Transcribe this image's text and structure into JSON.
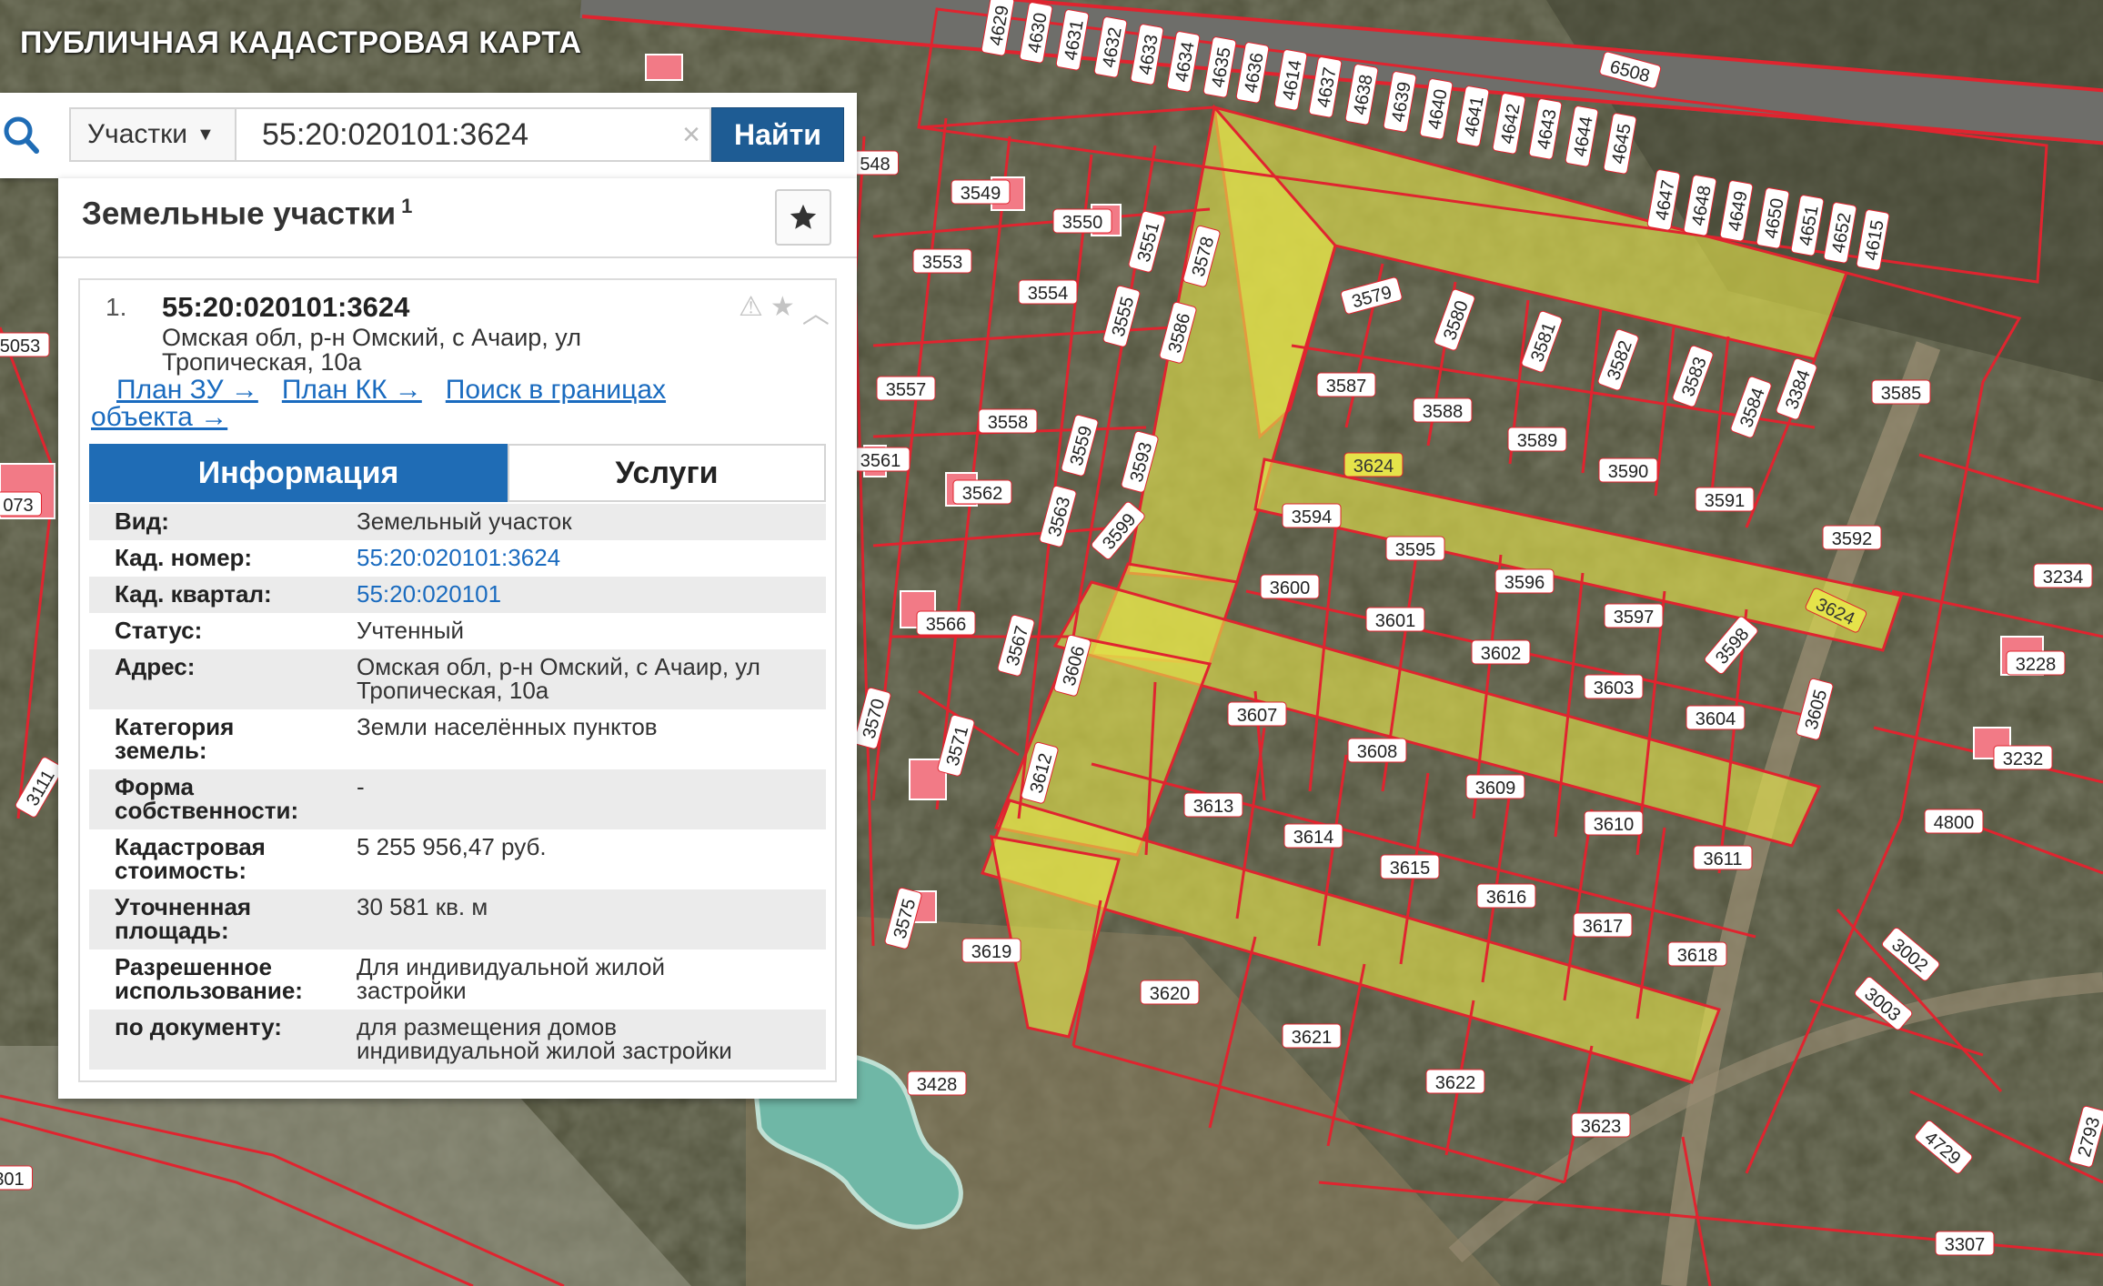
{
  "app": {
    "title": "ПУБЛИЧНАЯ КАДАСТРОВАЯ КАРТА"
  },
  "search": {
    "layer": "Участки",
    "query": "55:20:020101:3624",
    "clear": "×",
    "button": "Найти"
  },
  "panel": {
    "title": "Земельные участки",
    "count": "1",
    "result": {
      "index": "1.",
      "cad_number": "55:20:020101:3624",
      "address_line1": "Омская обл, р-н Омский, с Ачаир, ул",
      "address_line2": "Тропическая, 10а"
    },
    "links": {
      "plan_zu": "План ЗУ →",
      "plan_kk": "План КК →",
      "search_bounds_1": "Поиск в границах",
      "search_bounds_2": "объекта →"
    },
    "tabs": {
      "info": "Информация",
      "services": "Услуги"
    },
    "rows": [
      {
        "k1": "Вид:",
        "k2": "",
        "v1": "Земельный участок",
        "v2": ""
      },
      {
        "k1": "Кад. номер:",
        "k2": "",
        "v1": "55:20:020101:3624",
        "v2": ""
      },
      {
        "k1": "Кад. квартал:",
        "k2": "",
        "v1": "55:20:020101",
        "v2": ""
      },
      {
        "k1": "Статус:",
        "k2": "",
        "v1": "Учтенный",
        "v2": ""
      },
      {
        "k1": "Адрес:",
        "k2": "",
        "v1": "Омская обл, р-н Омский, с Ачаир, ул",
        "v2": "Тропическая, 10а"
      },
      {
        "k1": "Категория",
        "k2": "земель:",
        "v1": "Земли населённых пунктов",
        "v2": ""
      },
      {
        "k1": "Форма",
        "k2": "собственности:",
        "v1": "-",
        "v2": ""
      },
      {
        "k1": "Кадастровая",
        "k2": "стоимость:",
        "v1": "5 255 956,47 руб.",
        "v2": ""
      },
      {
        "k1": "Уточненная",
        "k2": "площадь:",
        "v1": "30 581 кв. м",
        "v2": ""
      },
      {
        "k1": "Разрешенное",
        "k2": "использование:",
        "v1": "Для индивидуальной жилой",
        "v2": "застройки"
      },
      {
        "k1": "по документу:",
        "k2": "",
        "v1": "для размещения домов",
        "v2": "индивидуальной жилой застройки"
      }
    ]
  },
  "map": {
    "road_label": "6508",
    "selected_labels": [
      "3624",
      "3624"
    ],
    "top_row": [
      "4629",
      "4630",
      "4631",
      "4632",
      "4633",
      "4634",
      "4635",
      "4636",
      "4614",
      "4637",
      "4638",
      "4639",
      "4640",
      "4641",
      "4642",
      "4643",
      "4644",
      "4645",
      "4647",
      "4648",
      "4649",
      "4650",
      "4651",
      "4652",
      "4615"
    ],
    "parcels": [
      "3549",
      "3550",
      "3551",
      "3578",
      "3553",
      "3554",
      "3555",
      "3586",
      "3579",
      "3580",
      "3581",
      "3582",
      "3583",
      "3584",
      "3384",
      "3585",
      "3557",
      "3558",
      "3559",
      "3593",
      "3587",
      "3588",
      "3589",
      "3590",
      "3591",
      "3561",
      "3562",
      "3563",
      "3599",
      "3594",
      "3595",
      "3596",
      "3597",
      "3598",
      "3592",
      "3600",
      "3601",
      "3602",
      "3603",
      "3604",
      "3566",
      "3567",
      "3606",
      "3605",
      "3607",
      "3608",
      "3609",
      "3610",
      "3611",
      "3570",
      "3571",
      "3612",
      "3613",
      "3614",
      "3615",
      "3616",
      "3617",
      "3618",
      "3575",
      "3619",
      "3620",
      "3621",
      "3622",
      "3623",
      "3428",
      "3234",
      "3228",
      "3232",
      "4800",
      "3002",
      "3003",
      "4729",
      "3307",
      "5053",
      "3111",
      "548",
      "073",
      "301",
      "2793"
    ]
  },
  "colors": {
    "accent": "#1f6cb5",
    "parcel_border": "#e0242f",
    "selected_fill": "#e5e34a",
    "label_bg": "#ffffff"
  }
}
